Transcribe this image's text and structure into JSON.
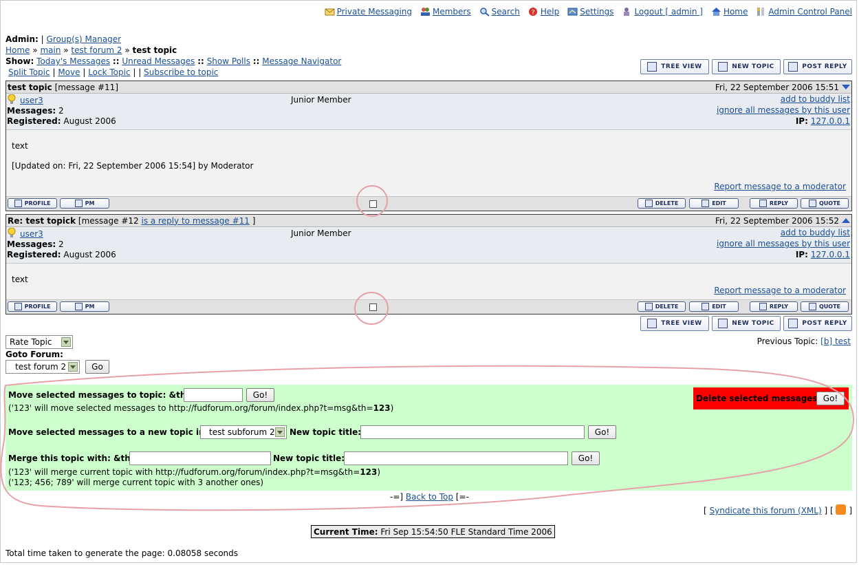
{
  "topnav": [
    {
      "label": "Private Messaging",
      "icon": "envelope-icon"
    },
    {
      "label": "Members",
      "icon": "members-icon"
    },
    {
      "label": "Search",
      "icon": "search-icon"
    },
    {
      "label": "Help",
      "icon": "help-icon"
    },
    {
      "label": "Settings",
      "icon": "settings-icon"
    },
    {
      "label": "Logout [ admin ]",
      "icon": "logout-icon"
    },
    {
      "label": "Home",
      "icon": "home-icon"
    },
    {
      "label": "Admin Control Panel",
      "icon": "admin-icon"
    }
  ],
  "admin": {
    "label": "Admin:",
    "sep": "|",
    "groups_link": "Group(s) Manager"
  },
  "breadcrumb": {
    "home": "Home",
    "sep": "»",
    "main": "main",
    "forum": "test forum 2",
    "current": "test topic"
  },
  "show": {
    "label": "Show:",
    "todays": "Today's Messages",
    "sep": "::",
    "unread": "Unread Messages",
    "polls": "Show Polls",
    "navigator": "Message Navigator"
  },
  "topic_actions": {
    "split": "Split Topic",
    "sep": "|",
    "move": "Move",
    "lock": "Lock Topic",
    "subscribe": "Subscribe to topic"
  },
  "top_buttons": {
    "tree": "TREE VIEW",
    "new_topic": "NEW TOPIC",
    "post_reply": "POST REPLY"
  },
  "messages": [
    {
      "title": "test topic",
      "meta": "[message #11]",
      "reply_link": "",
      "meta_end": "",
      "date": "Fri, 22 September 2006 15:51",
      "arrow": "down",
      "user": "user3",
      "rank": "Junior Member",
      "messages_label": "Messages:",
      "messages_count": "2",
      "registered_label": "Registered:",
      "registered": "August 2006",
      "buddy": "add to buddy list",
      "ignore": "ignore all messages by this user",
      "ip_label": "IP:",
      "ip": "127.0.0.1",
      "body": "text",
      "updated": "[Updated on: Fri, 22 September 2006 15:54] by Moderator",
      "report": "Report message to a moderator"
    },
    {
      "title": "Re: test topick",
      "meta": "[message #12",
      "reply_link": "is a reply to message #11",
      "meta_end": "]",
      "date": "Fri, 22 September 2006 15:52",
      "arrow": "up",
      "user": "user3",
      "rank": "Junior Member",
      "messages_label": "Messages:",
      "messages_count": "2",
      "registered_label": "Registered:",
      "registered": "August 2006",
      "buddy": "add to buddy list",
      "ignore": "ignore all messages by this user",
      "ip_label": "IP:",
      "ip": "127.0.0.1",
      "body": "text",
      "updated": "",
      "report": "Report message to a moderator"
    }
  ],
  "msg_buttons": {
    "profile": "PROFILE",
    "pm": "PM",
    "delete": "DELETE",
    "edit": "EDIT",
    "reply": "REPLY",
    "quote": "QUOTE"
  },
  "rate": {
    "label": "Rate Topic"
  },
  "goto": {
    "label": "Goto Forum:",
    "value": "test forum 2",
    "go": "Go"
  },
  "prev_topic": {
    "label": "Previous Topic:",
    "link": "[b] test"
  },
  "mod": {
    "move_label": "Move selected messages to topic: &th=",
    "move_go": "Go!",
    "move_hint_pre": "('123' will move selected messages to http://fudforum.org/forum/index.php?t=msg&th=",
    "move_hint_num": "123",
    "move_hint_post": ")",
    "newtopic_label": "Move selected messages to a new topic in",
    "newtopic_select": "test subforum 2",
    "newtopic_title_label": "New topic title:",
    "newtopic_go": "Go!",
    "merge_label": "Merge this topic with: &th=",
    "merge_title_label": "New topic title:",
    "merge_go": "Go!",
    "merge_hint1_pre": "('123' will merge current topic with http://fudforum.org/forum/index.php?t=msg&th=",
    "merge_hint1_num": "123",
    "merge_hint1_post": ")",
    "merge_hint2": "('123; 456; 789' will merge current topic with 3 another ones)",
    "delete_label": "Delete selected messages",
    "delete_go": "Go!"
  },
  "back_top": {
    "pre": "-=]",
    "link": "Back to Top",
    "post": "[=-"
  },
  "syndicate": {
    "open": "[",
    "link": "Syndicate this forum (XML)",
    "mid": "] [",
    "close": "]"
  },
  "current_time": {
    "label": "Current Time:",
    "value": "Fri Sep 15:54:50 FLE Standard Time 2006"
  },
  "gen_time": "Total time taken to generate the page: 0.08058 seconds",
  "colors": {
    "link": "#1a4f96",
    "mod_panel": "#ccffcc",
    "delete_panel": "#ff0000",
    "annotation": "#e8a0a8"
  }
}
